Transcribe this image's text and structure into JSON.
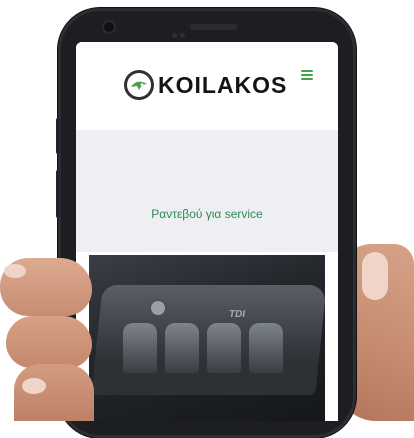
{
  "site": {
    "brand": "KOILAKOS",
    "banner_text": "Ραντεβού για service"
  },
  "icons": {
    "logo": "skoda-winged-arrow-icon",
    "menu": "hamburger-menu-icon",
    "camera": "camera-icon"
  },
  "colors": {
    "accent_green": "#47a34a",
    "banner_text": "#2f8a53",
    "banner_bg": "#edeff2",
    "brand_text": "#131416"
  },
  "images": {
    "banner_photo": "car-engine-cover-photo"
  }
}
